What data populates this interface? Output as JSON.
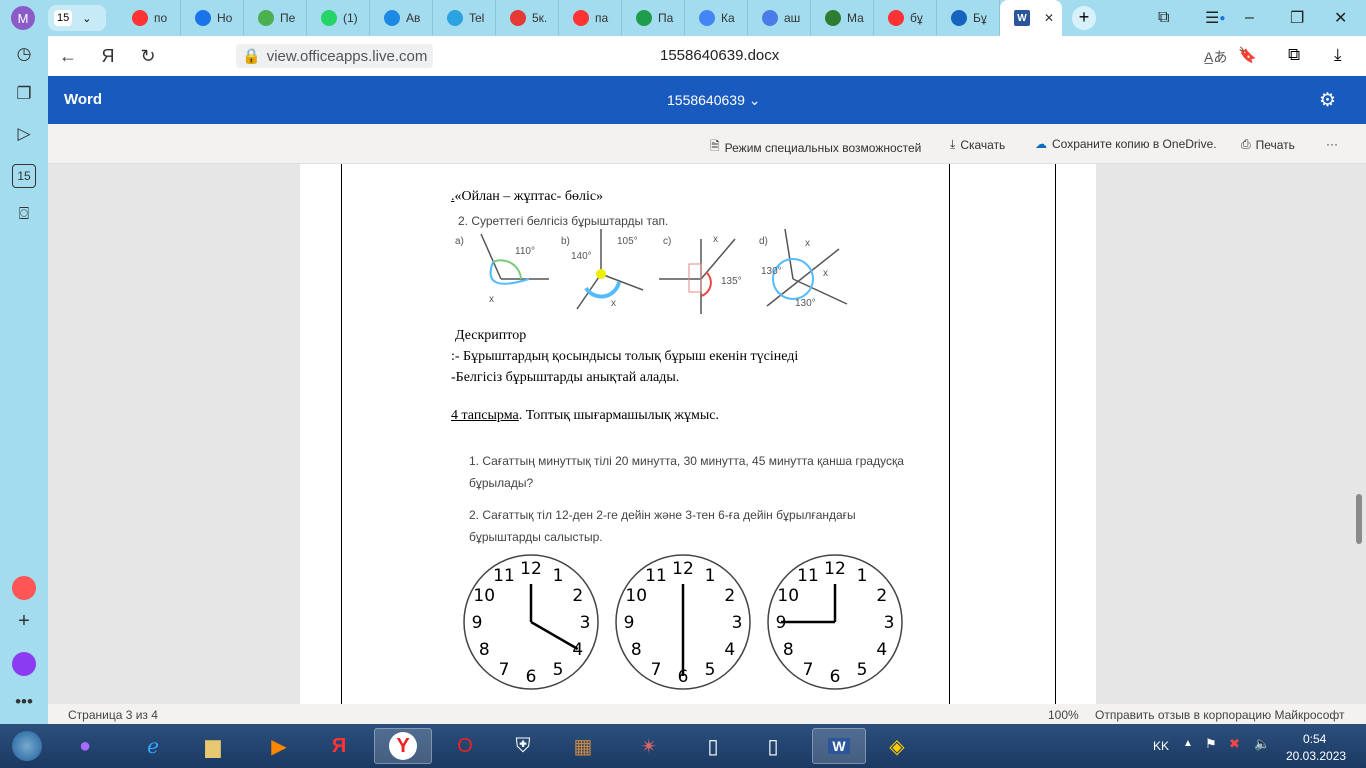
{
  "browser": {
    "profile_initial": "M",
    "tab_group_count": "15",
    "tabs": [
      {
        "icon": "yandex-icon",
        "label": "по",
        "color": "#f33"
      },
      {
        "icon": "mail-icon",
        "label": "Но",
        "color": "#1a73e8"
      },
      {
        "icon": "sheet-icon",
        "label": "Пе",
        "color": "#4caf50"
      },
      {
        "icon": "whatsapp-icon",
        "label": "(1)",
        "color": "#25d366"
      },
      {
        "icon": "butterfly-icon",
        "label": "Ав",
        "color": "#1e88e5"
      },
      {
        "icon": "telegram-icon",
        "label": "Tel",
        "color": "#2aa3e0"
      },
      {
        "icon": "pdf-icon",
        "label": "5к.",
        "color": "#e53935"
      },
      {
        "icon": "yandex-icon",
        "label": "па",
        "color": "#f33"
      },
      {
        "icon": "b-icon",
        "label": "Па",
        "color": "#1e9e4c"
      },
      {
        "icon": "cube-icon",
        "label": "Ка",
        "color": "#4285f4"
      },
      {
        "icon": "u-icon",
        "label": "аш",
        "color": "#4a7ce8"
      },
      {
        "icon": "book-icon",
        "label": "Ма",
        "color": "#2e7d32"
      },
      {
        "icon": "yandex-icon",
        "label": "бұ",
        "color": "#f33"
      },
      {
        "icon": "u-logo-icon",
        "label": "Бұ",
        "color": "#1565c0"
      }
    ],
    "active_tab": {
      "icon": "word-icon",
      "label": "W"
    },
    "url": "view.officeapps.live.com",
    "page_title": "1558640639.docx"
  },
  "word": {
    "brand": "Word",
    "file_name": "1558640639",
    "toolbar": {
      "accessibility": "Режим специальных возможностей",
      "download": "Скачать",
      "save_copy": "Сохраните копию в OneDrive.",
      "print": "Печать",
      "more": "···"
    },
    "document": {
      "heading": "«Ойлан – жұптас- бөліс»",
      "heading_prefix": ".",
      "task2": "2.   Суреттегі белгісіз бұрыштарды тап.",
      "figures": [
        {
          "label": "a)",
          "angles": [
            "110°",
            "x"
          ]
        },
        {
          "label": "b)",
          "angles": [
            "140°",
            "105°",
            "x"
          ]
        },
        {
          "label": "c)",
          "angles": [
            "x",
            "135°"
          ]
        },
        {
          "label": "d)",
          "angles": [
            "130°",
            "x",
            "x",
            "130°"
          ]
        }
      ],
      "descriptor_title": "Дескриптор",
      "descriptor_1": ":- Бұрыштардың  қосындысы толық бұрыш екенін  түсінеді",
      "descriptor_2": "-Белгісіз  бұрыштарды  анықтай алады.",
      "task4_num": "4   тапсырма",
      "task4_rest": ". Топтық шығармашылық жұмыс.",
      "q1_a": "1.    Сағаттың минуттық тілі 20 минутта, 30 минутта, 45 минутта қанша градусқа",
      "q1_b": "бұрылады?",
      "q2_a": "2.  Сағаттық  тіл  12-ден  2-ге  дейін  және  3-тен  6-ға  дейін  бұрылғандағы",
      "q2_b": "бұрыштарды салыстыр.",
      "clock_numbers": [
        "12",
        "1",
        "2",
        "3",
        "4",
        "5",
        "6",
        "7",
        "8",
        "9",
        "10",
        "11"
      ],
      "clocks": [
        {
          "time": "4:00"
        },
        {
          "time": "6:00"
        },
        {
          "time": "9:00"
        }
      ]
    },
    "status": {
      "page": "Страница 3 из 4",
      "zoom": "100%",
      "feedback": "Отправить отзыв в корпорацию Майкрософт"
    }
  },
  "taskbar": {
    "lang": "KK",
    "time": "0:54",
    "date": "20.03.2023"
  }
}
